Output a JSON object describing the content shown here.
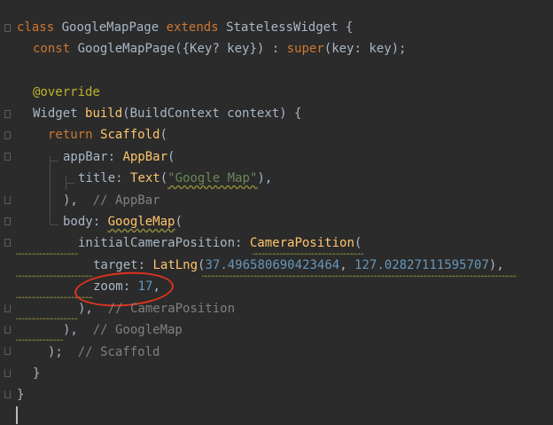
{
  "theme": {
    "background": "#2b2b2b",
    "highlight": "#e0321e"
  },
  "code": {
    "l1": {
      "kw1": "class",
      "name": "GoogleMapPage",
      "kw2": "extends",
      "sup": "StatelessWidget",
      "brace": " {"
    },
    "l2": {
      "kw": "const",
      "name": "GoogleMapPage",
      "rest1": "({Key? key}) : ",
      "sup": "super",
      "rest2": "(key: key);"
    },
    "l4": {
      "ann": "@override"
    },
    "l5": {
      "type": "Widget",
      "fn": "build",
      "rest": "(BuildContext context) {"
    },
    "l6": {
      "kw": "return",
      "fn": "Scaffold",
      "rest": "("
    },
    "l7": {
      "param": "appBar:",
      "fn": "AppBar",
      "rest": "("
    },
    "l8": {
      "param": "title:",
      "fn": "Text",
      "open": "(",
      "str": "\"Google Map\"",
      "close": "),"
    },
    "l9": {
      "code": "),",
      "cmt": "// AppBar"
    },
    "l10": {
      "param": "body:",
      "fn": "GoogleMap",
      "rest": "("
    },
    "l11": {
      "param": "initialCameraPosition:",
      "fn": "CameraPosition",
      "rest": "("
    },
    "l12": {
      "param": "target:",
      "fn": "LatLng",
      "open": "(",
      "lat": "37.496580690423464",
      "sep": ", ",
      "lng": "127.02827111595707",
      "close": "),"
    },
    "l13": {
      "param": "zoom:",
      "num": "17",
      "close": ","
    },
    "l14": {
      "code": "),",
      "cmt": "// CameraPosition"
    },
    "l15": {
      "code": "),",
      "cmt": "// GoogleMap"
    },
    "l16": {
      "code": ");",
      "cmt": "// Scaffold"
    },
    "l17": {
      "code": "}"
    },
    "l18": {
      "code": "}"
    }
  }
}
